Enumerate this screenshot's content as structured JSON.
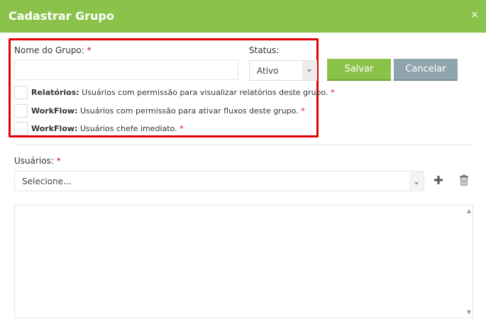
{
  "dialog": {
    "title": "Cadastrar Grupo",
    "close_icon": "×"
  },
  "form": {
    "group_name_label": "Nome do Grupo:",
    "group_name_value": "",
    "required_mark": "*",
    "status_label": "Status:",
    "status_value": "Ativo",
    "permissions": [
      {
        "name": "Relatórios:",
        "desc": "Usuários com permissão para visualizar relatórios deste grupo.",
        "checked": false
      },
      {
        "name": "WorkFlow:",
        "desc": "Usuários com permissão para ativar fluxos deste grupo.",
        "checked": false
      },
      {
        "name": "WorkFlow:",
        "desc": "Usuários chefe imediato.",
        "checked": false
      }
    ],
    "users_label": "Usuários:",
    "users_select_value": "Selecione..."
  },
  "buttons": {
    "save": "Salvar",
    "cancel": "Cancelar"
  },
  "icons": {
    "add": "plus-icon",
    "delete": "trash-icon",
    "dropdown": "caret-down-icon"
  },
  "colors": {
    "header": "#8bc34a",
    "save": "#8bc34a",
    "cancel": "#90a4ae",
    "highlight": "#e30000",
    "required": "#e30000"
  }
}
